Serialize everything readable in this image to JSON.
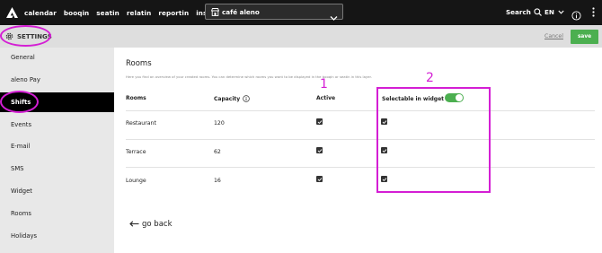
{
  "nav": {
    "items": [
      "calendar",
      "booqin",
      "seatin",
      "relatin",
      "reportin",
      "insights"
    ],
    "venue": "café aleno",
    "search_label": "Search",
    "language": "EN"
  },
  "settings_bar": {
    "title": "SETTINGS",
    "cancel_label": "Cancel",
    "save_label": "save"
  },
  "sidebar": {
    "items": [
      "General",
      "aleno Pay",
      "Shifts",
      "Events",
      "E-mail",
      "SMS",
      "Widget",
      "Rooms",
      "Holidays"
    ],
    "active": "Shifts"
  },
  "main": {
    "title": "Rooms",
    "subtitle": "Here you find an overview of your created rooms. You can determine which rooms you want to be displayed in the booqin or seatin in this layer.",
    "columns": {
      "rooms": "Rooms",
      "capacity": "Capacity",
      "active": "Active",
      "selectable": "Selectable in widget"
    },
    "rows": [
      {
        "name": "Restaurant",
        "capacity": "120",
        "active": true,
        "selectable": true
      },
      {
        "name": "Terrace",
        "capacity": "62",
        "active": true,
        "selectable": true
      },
      {
        "name": "Lounge",
        "capacity": "16",
        "active": true,
        "selectable": true
      }
    ],
    "selectable_toggle_on": true,
    "go_back_label": "go back"
  },
  "annotations": {
    "label_1": "1",
    "label_2": "2",
    "color": "#d41ed4"
  },
  "colors": {
    "accent": "#4caf50",
    "nav_bg": "#151515",
    "active_item_bg": "#000000"
  }
}
